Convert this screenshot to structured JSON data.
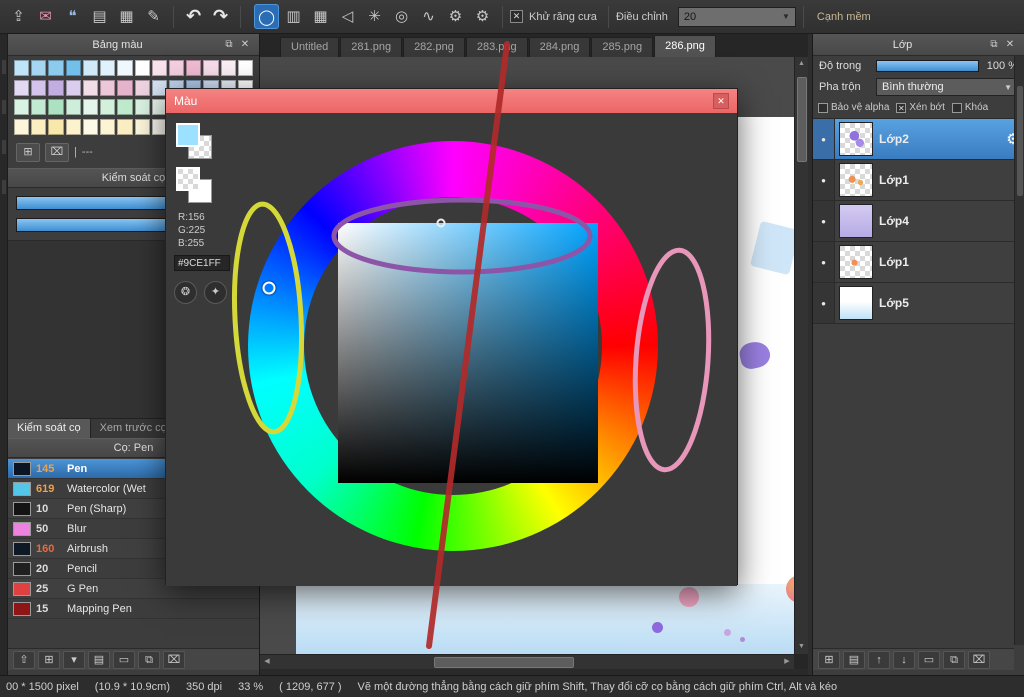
{
  "icons": {
    "eye": "●",
    "gear": "⚙",
    "close": "✕",
    "popout": "⧉",
    "caret": "▼",
    "check": "✕",
    "up_arrow": "▲",
    "down_arrow": "▼",
    "left_arrow": "◀",
    "right_arrow": "▶",
    "pipe": "|"
  },
  "toolbar": {
    "file_icons": [
      {
        "name": "export-icon",
        "glyph": "⇪"
      },
      {
        "name": "chat-icon",
        "glyph": "✉",
        "color": "#e890a8"
      },
      {
        "name": "comment-icon",
        "glyph": "❝",
        "color": "#9ab8e0"
      },
      {
        "name": "document-icon",
        "glyph": "▤"
      },
      {
        "name": "grid-document-icon",
        "glyph": "▦"
      },
      {
        "name": "edit-document-icon",
        "glyph": "✎"
      }
    ],
    "history_icons": [
      {
        "name": "undo-icon",
        "glyph": "↶"
      },
      {
        "name": "redo-icon",
        "glyph": "↷"
      }
    ],
    "tool_icons": [
      {
        "name": "ellipse-tool-icon",
        "glyph": "◯",
        "selected": true
      },
      {
        "name": "gradient-tool-icon",
        "glyph": "▥"
      },
      {
        "name": "tile-tool-icon",
        "glyph": "▦"
      },
      {
        "name": "polygon-tool-icon",
        "glyph": "◁"
      },
      {
        "name": "symmetry-tool-icon",
        "glyph": "✳"
      },
      {
        "name": "rings-tool-icon",
        "glyph": "◎"
      },
      {
        "name": "curve-tool-icon",
        "glyph": "∿"
      },
      {
        "name": "tool-settings-ring-icon",
        "glyph": "⚙"
      },
      {
        "name": "settings-icon",
        "glyph": "⚙"
      }
    ],
    "antialias_label": "Khử răng cưa",
    "adjust_label": "Điều chỉnh",
    "adjust_value": "20",
    "soft_edge_label": "Cạnh mềm"
  },
  "document_tabs": {
    "tabs": [
      {
        "label": "Untitled"
      },
      {
        "label": "281.png"
      },
      {
        "label": "282.png"
      },
      {
        "label": "283.png"
      },
      {
        "label": "284.png"
      },
      {
        "label": "285.png"
      },
      {
        "label": "286.png",
        "selected": true
      }
    ]
  },
  "left_panel": {
    "palette": {
      "title": "Bảng màu",
      "footer_label": "---",
      "colors": [
        "#bfe3f7",
        "#a5d7f2",
        "#8ccbee",
        "#72bfe9",
        "#cfe9f8",
        "#dff1fb",
        "#eff8fd",
        "#ffffff",
        "#f9e4ee",
        "#f4cfe0",
        "#efbad2",
        "#f6dcea",
        "#fbeef5",
        "#ffffff",
        "#e4d9f2",
        "#d4c3ea",
        "#c3ade1",
        "#dbcdee",
        "#f2dce8",
        "#ebc7d9",
        "#e5b3cb",
        "#f0d3e1",
        "#d8e5f6",
        "#c2d7f1",
        "#acc9ec",
        "#d0def4",
        "#e8eef9",
        "#ffffff",
        "#d8f2e4",
        "#c2ead3",
        "#ace2c2",
        "#cdeeda",
        "#e4f6ec",
        "#d2f0dc",
        "#c0eacc",
        "#daf2e2",
        "#eef9f2",
        "#ffffff",
        "#f2f9ee",
        "#e2f2d8",
        "#d2ecc2",
        "#c2e6ac",
        "#fdf6da",
        "#fbefc2",
        "#f9e8ab",
        "#fcf2cd",
        "#fef9e6",
        "#fdf4d4",
        "#fbeec2",
        "#fdf6dc",
        "#fffdf2",
        "#ffffff",
        "#fef2ea",
        "#fce4d4",
        "#fad6bf",
        "#f8c8aa"
      ]
    },
    "brush_control": {
      "title": "Kiểm soát cọ"
    },
    "bottom_tabs": [
      {
        "label": "Kiểm soát cọ",
        "selected": true
      },
      {
        "label": "Xem trước cọ"
      }
    ],
    "brush_list": {
      "header": "Cọ: Pen",
      "brushes": [
        {
          "size": "145",
          "name": "Pen",
          "swatch": "#0b1524",
          "size_color": "#f0a04a",
          "selected": true
        },
        {
          "size": "619",
          "name": "Watercolor (Wet",
          "swatch": "#54c6e8",
          "size_color": "#f0a04a"
        },
        {
          "size": "10",
          "name": "Pen (Sharp)",
          "swatch": "#141414",
          "size_color": "#dddddd"
        },
        {
          "size": "50",
          "name": "Blur",
          "swatch": "#ee82e0",
          "size_color": "#dddddd"
        },
        {
          "size": "160",
          "name": "Airbrush",
          "swatch": "#0d1a26",
          "size_color": "#e86a40"
        },
        {
          "size": "20",
          "name": "Pencil",
          "swatch": "#202020",
          "size_color": "#dddddd"
        },
        {
          "size": "25",
          "name": "G Pen",
          "swatch": "#e04040",
          "size_color": "#dddddd"
        },
        {
          "size": "15",
          "name": "Mapping Pen",
          "swatch": "#8e1616",
          "size_color": "#dddddd"
        }
      ]
    },
    "bottom_icons": [
      {
        "name": "upload-brush-icon",
        "glyph": "⇧"
      },
      {
        "name": "new-brush-icon",
        "glyph": "⊞"
      },
      {
        "name": "brush-menu-icon",
        "glyph": "▾"
      },
      {
        "name": "brush-script-icon",
        "glyph": "▤"
      },
      {
        "name": "brush-folder-icon",
        "glyph": "▭"
      },
      {
        "name": "duplicate-brush-icon",
        "glyph": "⧉"
      },
      {
        "name": "delete-brush-icon",
        "glyph": "⌧"
      }
    ]
  },
  "color_dialog": {
    "title": "Màu",
    "current_color": "#9CE1FF",
    "rgb_lines": [
      "R:156",
      "G:225",
      "B:255"
    ],
    "hex": "#9CE1FF",
    "buttons": [
      {
        "name": "palette-button",
        "glyph": "❂"
      },
      {
        "name": "palette-add-button",
        "glyph": "✦"
      }
    ]
  },
  "right_panel": {
    "title": "Lớp",
    "opacity_label": "Độ trong",
    "opacity_value": "100 %",
    "blend_label": "Pha trộn",
    "blend_value": "Bình thường",
    "alpha_label": "Bảo vệ alpha",
    "clip_label": "Xén bớt",
    "lock_label": "Khóa",
    "layers": [
      {
        "name": "Lớp2",
        "selected": true,
        "thumb_bg": "radial-gradient(circle at 45% 40%, #8f72e0 0 18%, transparent 19%), radial-gradient(circle at 62% 62%, #a58ae8 0 14%, transparent 15%), repeating-conic-gradient(#ffffff 0% 25%, #d9d9d9 0% 50%) 0 0 / 10px 10px"
      },
      {
        "name": "Lớp1",
        "thumb_bg": "radial-gradient(circle at 38% 48%, #f29052 0 13%, transparent 14%), radial-gradient(circle at 64% 58%, #f2a852 0 9%, transparent 10%), repeating-conic-gradient(#ffffff 0% 25%, #d9d9d9 0% 50%) 0 0 / 10px 10px"
      },
      {
        "name": "Lớp4",
        "thumb_bg": "linear-gradient(180deg, #d4cbf0, #b7aae6)"
      },
      {
        "name": "Lớp1",
        "thumb_bg": "radial-gradient(circle at 45% 52%, #f29052 0 12%, transparent 13%), repeating-conic-gradient(#ffffff 0% 25%, #d9d9d9 0% 50%) 0 0 / 10px 10px"
      },
      {
        "name": "Lớp5",
        "thumb_bg": "linear-gradient(180deg, #ffffff 45%, #bfe2f6)"
      }
    ],
    "bottom_icons": [
      {
        "name": "new-layer-icon",
        "glyph": "⊞"
      },
      {
        "name": "layer-script-icon",
        "glyph": "▤"
      },
      {
        "name": "layer-up-icon",
        "glyph": "↑"
      },
      {
        "name": "layer-down-icon",
        "glyph": "↓"
      },
      {
        "name": "new-folder-icon",
        "glyph": "▭"
      },
      {
        "name": "duplicate-layer-icon",
        "glyph": "⧉"
      },
      {
        "name": "delete-layer-icon",
        "glyph": "⌧"
      }
    ]
  },
  "status_bar": {
    "segments": [
      "00 * 1500 pixel",
      "(10.9 * 10.9cm)",
      "350 dpi",
      "33 %",
      "( 1209, 677 )",
      "Vẽ một đường thẳng bằng cách giữ phím Shift, Thay đổi cỡ cọ bằng cách giữ phím Ctrl, Alt và kéo"
    ]
  },
  "annotation_colors": {
    "red_line": "#b22a2a",
    "yellow_ellipse": "#d4d838",
    "purple_ellipse": "#8d55a8",
    "pink_ellipse": "#e897ba"
  }
}
